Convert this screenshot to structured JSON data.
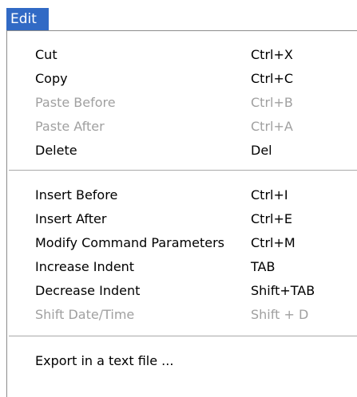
{
  "menu": {
    "title": "Edit",
    "items": [
      {
        "label": "Cut",
        "shortcut": "Ctrl+X",
        "enabled": true
      },
      {
        "label": "Copy",
        "shortcut": "Ctrl+C",
        "enabled": true
      },
      {
        "label": "Paste Before",
        "shortcut": "Ctrl+B",
        "enabled": false
      },
      {
        "label": "Paste After",
        "shortcut": "Ctrl+A",
        "enabled": false
      },
      {
        "label": "Delete",
        "shortcut": "Del",
        "enabled": true
      },
      {
        "label": "Insert Before",
        "shortcut": "Ctrl+I",
        "enabled": true
      },
      {
        "label": "Insert After",
        "shortcut": "Ctrl+E",
        "enabled": true
      },
      {
        "label": "Modify Command Parameters",
        "shortcut": "Ctrl+M",
        "enabled": true
      },
      {
        "label": "Increase Indent",
        "shortcut": "TAB",
        "enabled": true
      },
      {
        "label": "Decrease Indent",
        "shortcut": "Shift+TAB",
        "enabled": true
      },
      {
        "label": "Shift Date/Time",
        "shortcut": "Shift + D",
        "enabled": false
      },
      {
        "label": "Export in a text file ...",
        "shortcut": "",
        "enabled": true
      }
    ]
  },
  "colors": {
    "menu_highlight": "#316ac5",
    "disabled_text": "#a0a0a0",
    "enabled_text": "#000000"
  }
}
